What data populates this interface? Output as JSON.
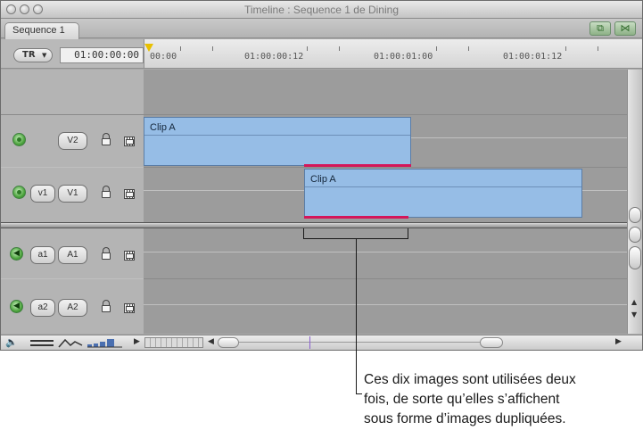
{
  "window": {
    "title": "Timeline : Sequence 1 de Dining",
    "traffic_lights": [
      "close",
      "minimize",
      "zoom"
    ]
  },
  "tabs": [
    {
      "label": "Sequence 1",
      "active": true
    }
  ],
  "toolbar": {
    "snapping_icon": "snap-icon",
    "linking_icon": "link-icon"
  },
  "timecode": {
    "track_selector": "TR",
    "current": "01:00:00:00"
  },
  "ruler": {
    "labels": [
      "00:00",
      "01:00:00:12",
      "01:00:01:00",
      "01:00:01:12"
    ]
  },
  "tracks": {
    "video": [
      {
        "target": "",
        "label": "V2"
      },
      {
        "target": "v1",
        "label": "V1"
      }
    ],
    "audio": [
      {
        "target": "a1",
        "label": "A1"
      },
      {
        "target": "a2",
        "label": "A2"
      }
    ]
  },
  "clips": [
    {
      "track": "V2",
      "label": "Clip A"
    },
    {
      "track": "V1",
      "label": "Clip A"
    }
  ],
  "colors": {
    "clip_fill": "#96bde6",
    "duplicate_frame_bar": "#d4165a",
    "playhead": "#e8c000"
  },
  "callout": {
    "lines": [
      "Ces dix images sont utilisées deux",
      "fois, de sorte qu’elles s’affichent",
      "sous forme d’images dupliquées."
    ]
  }
}
